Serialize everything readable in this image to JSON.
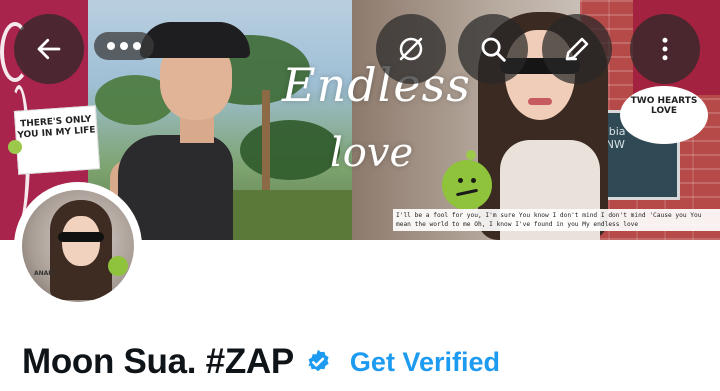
{
  "banner": {
    "title_line1": "Endless",
    "title_line2": "love",
    "note_left": "THERE'S ONLY YOU IN MY LIFE",
    "note_right": "TWO HEARTS LOVE",
    "lyric": "I'll be a fool for you, I'm sure You know I don't mind I don't mind 'Cause you You mean the world to me Oh, I know I've found in you My endless love",
    "shop_sign": "mbia\nt NW",
    "avatar_tag": "ANAIS"
  },
  "header_actions": {
    "back": "back-arrow-icon",
    "notifications": "bell-off-icon",
    "search": "search-icon",
    "edit": "pencil-icon",
    "more": "more-vertical-icon"
  },
  "profile": {
    "display_name": "Moon Sua. #ZAP",
    "verified_icon": "verified-badge-icon",
    "get_verified_label": "Get Verified"
  },
  "colors": {
    "accent": "#1d9bf0",
    "text": "#0f1419",
    "button_overlay": "#2a2a2a",
    "magenta": "#a8244d",
    "smiley_green": "#8ec33b"
  }
}
